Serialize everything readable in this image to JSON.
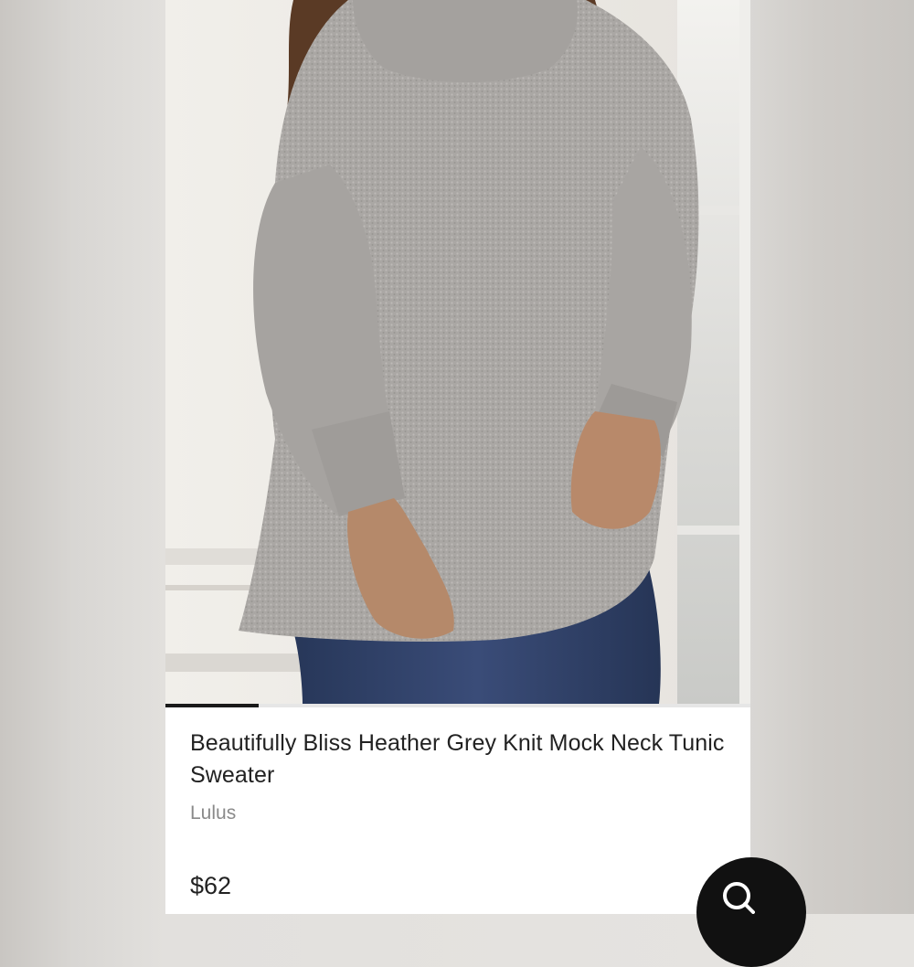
{
  "product": {
    "title": "Beautifully Bliss Heather Grey Knit Mock Neck Tunic Sweater",
    "brand": "Lulus",
    "price": "$62",
    "image_alt": "model wearing grey knit mock neck tunic sweater with jeans"
  },
  "gallery": {
    "progress": 0.16
  },
  "colors": {
    "accent": "#1a1a1a",
    "sweater": "#a9a6a3",
    "denim": "#2f4169"
  },
  "icons": {
    "fab": "search-icon"
  }
}
